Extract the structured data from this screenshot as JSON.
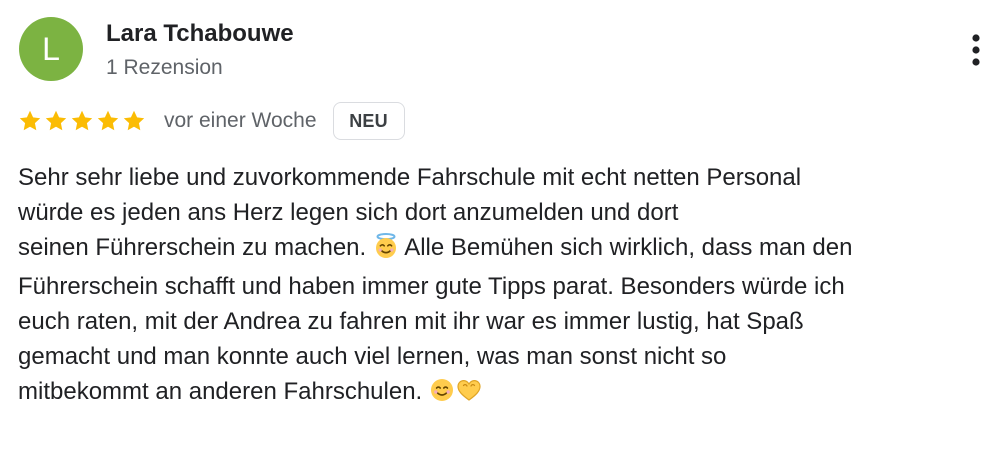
{
  "review": {
    "avatar": {
      "initial": "L",
      "color": "#7cb342"
    },
    "author": {
      "name": "Lara Tchabouwe",
      "review_count": "1 Rezension"
    },
    "menu_icon": "more-vert-icon",
    "rating": {
      "stars": 5,
      "max": 5,
      "star_color": "#fbbc04"
    },
    "date": "vor einer Woche",
    "badge": "NEU",
    "text_lines": {
      "l1": "Sehr sehr liebe und zuvorkommende Fahrschule mit echt netten Personal",
      "l2": "würde es jeden ans Herz legen sich dort anzumelden und dort",
      "l3a": "seinen Führerschein zu machen.",
      "l3b": "Alle Bemühen sich wirklich, dass man den",
      "l4": "Führerschein schafft und haben immer gute Tipps parat. Besonders würde ich",
      "l5": "euch raten, mit der Andrea zu fahren mit ihr war es immer lustig, hat Spaß",
      "l6": "gemacht und man konnte auch viel lernen, was man sonst nicht so",
      "l7": "mitbekommt an anderen Fahrschulen."
    },
    "emojis": {
      "halo": "smiling-face-with-halo-icon",
      "smile": "smiling-face-icon",
      "heart_hands": "heart-hands-icon"
    }
  }
}
